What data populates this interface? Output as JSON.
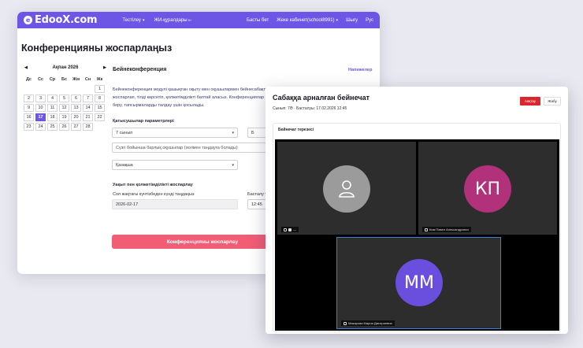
{
  "navbar": {
    "logo": "EdooX.com",
    "logo_mark": "e",
    "items_left": [
      {
        "label": "Тестілеу",
        "has_caret": true
      },
      {
        "label": "ЖИ-құралдары",
        "badge": "5+"
      }
    ],
    "items_right": [
      {
        "label": "Басты бет",
        "has_caret": false
      },
      {
        "label": "Жеке кабинет(school8991)",
        "has_caret": true
      },
      {
        "label": "Шығу",
        "has_caret": false
      },
      {
        "label": "Рус",
        "has_caret": false
      }
    ],
    "caret": "▾"
  },
  "page_title": "Конференцияны жоспарлаңыз",
  "calendar": {
    "month_label": "Ақпан 2026",
    "prev_arrow": "◀",
    "next_arrow": "▶",
    "weekdays": [
      "Дс",
      "Сс",
      "Ср",
      "Бс",
      "Жм",
      "Сн",
      "Жк"
    ],
    "weeks": [
      [
        "",
        "",
        "",
        "",
        "",
        "",
        "1"
      ],
      [
        "2",
        "3",
        "4",
        "5",
        "6",
        "7",
        "8"
      ],
      [
        "9",
        "10",
        "11",
        "12",
        "13",
        "14",
        "15"
      ],
      [
        "16",
        "17",
        "18",
        "19",
        "20",
        "21",
        "22"
      ],
      [
        "23",
        "24",
        "25",
        "26",
        "27",
        "28",
        ""
      ]
    ],
    "selected_day": "17"
  },
  "conference": {
    "section_title": "Бейнеконференция",
    "settings_link": "Напижелер",
    "description": "Бейнеконференция модулі қашықтан оқыту мен оқушылармен бейнесабақтарды жоспарлап, тілді көрсетіп, қолжетімділікті баптай аласыз. Конференциялар кеңес беру, тапсырмаларды талдау үшін қосылады.",
    "participants_label": "Қатысушылар параметрлері",
    "grade_value": "7 сынып",
    "letter_value": "Б",
    "students_placeholder": "Сүзгі бойынша барлық оқушылар (әолмен таңдауға болады)",
    "subject_value": "Қазақша",
    "time_section_label": "Уақыт пен қолжетімділікті жоспарлау",
    "date_label": "Сол жақтағы күнтізбеден күнді таңдаңыз",
    "date_value": "2026-02-17",
    "start_label": "Басталу у",
    "start_value": "12:45",
    "dropdown_arrow": "▾",
    "submit_label": "Конференцияны жоспарлау"
  },
  "lesson_window": {
    "title": "Сабаққа арналған бейнечат",
    "meta": "Сынып: 7Ә · Басталуы: 17.02.2026 12:45",
    "end_button": "Аяқтау",
    "close_button": "Жабу",
    "video_card_title": "Бейнечат терезесі",
    "tiles": [
      {
        "initials": "",
        "label": "—",
        "avatar_color": "#9b9b9b",
        "kind": "user-icon"
      },
      {
        "initials": "КП",
        "label": "Ким Павел Александрович",
        "avatar_color": "#b1327b",
        "kind": "initials"
      },
      {
        "initials": "ММ",
        "label": "Макарова Мария Дмитриевна",
        "avatar_color": "#6a4fde",
        "kind": "initials"
      }
    ]
  }
}
